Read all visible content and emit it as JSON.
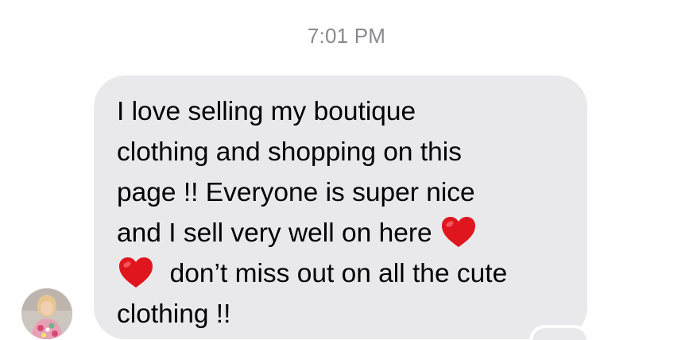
{
  "conversation": {
    "timestamp": "7:01 PM"
  },
  "message": {
    "line1": "I love selling my boutique",
    "line2": "clothing and shopping on this",
    "line3": "page !! Everyone is super nice",
    "line4": "and I sell very well on here",
    "line5": "don’t miss out on all the cute",
    "line6": "clothing !!",
    "emoji": "heart-emoji",
    "bubble_color": "#e9e9eb",
    "heart_color": "#e0161f"
  },
  "sender": {
    "avatar": "profile-photo"
  }
}
